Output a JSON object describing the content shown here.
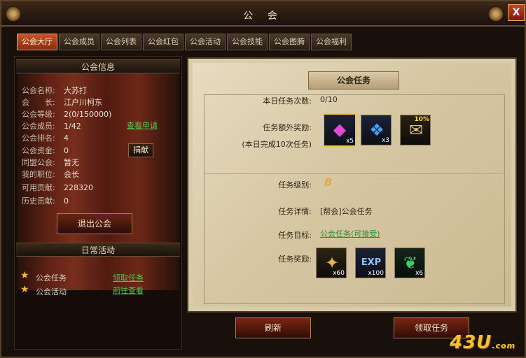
{
  "window": {
    "title": "公 会",
    "close_label": "X"
  },
  "tabs": [
    "公会大厅",
    "公会成员",
    "公会列表",
    "公会红包",
    "公会活动",
    "公会技能",
    "公会图腾",
    "公会福利"
  ],
  "left": {
    "info_header": "公会信息",
    "rows": [
      {
        "label": "公会名称:",
        "value": "大苏打"
      },
      {
        "label": "会　　长:",
        "value": "江户川柯东"
      },
      {
        "label": "公会等级:",
        "value": "2(0/150000)"
      },
      {
        "label": "公会成员:",
        "value": "1/42"
      },
      {
        "label": "公会排名:",
        "value": "4"
      },
      {
        "label": "公会资金:",
        "value": "0"
      },
      {
        "label": "同盟公会:",
        "value": "暂无"
      },
      {
        "label": "我的职位:",
        "value": "会长"
      },
      {
        "label": "可用贡献:",
        "value": "228320"
      },
      {
        "label": "历史贡献:",
        "value": "0"
      }
    ],
    "view_applications": "查看申请",
    "donate_label": "捐献",
    "quit_label": "退出公会",
    "daily_header": "日常活动",
    "daily": [
      {
        "name": "公会任务",
        "action": "领取任务"
      },
      {
        "name": "公会活动",
        "action": "前往查看"
      }
    ]
  },
  "mission": {
    "title": "公会任务",
    "count_label": "本日任务次数:",
    "count_value": "0/10",
    "extra_reward_label": "任务额外奖励:",
    "extra_reward_note": "(本日完成10次任务)",
    "extra_items": [
      {
        "icon": "purple-gem-icon",
        "glyph": "◆",
        "qty": "x5"
      },
      {
        "icon": "blue-flame-crystal-icon",
        "glyph": "❖",
        "qty": "x3"
      },
      {
        "icon": "scroll-icon",
        "glyph": "✉",
        "pct": "10%"
      }
    ],
    "level_label": "任务级别:",
    "level_value": "B",
    "detail_label": "任务详情:",
    "detail_value": "[帮会]公会任务",
    "target_label": "任务目标:",
    "target_value": "公会任务(可接受)",
    "reward_label": "任务奖励:",
    "reward_items": [
      {
        "icon": "contribution-token-icon",
        "glyph": "✦",
        "qty": "x60"
      },
      {
        "icon": "exp-icon",
        "glyph": "EXP",
        "qty": "x100"
      },
      {
        "icon": "green-leaf-icon",
        "glyph": "❦",
        "qty": "x6"
      }
    ]
  },
  "buttons": {
    "refresh": "刷新",
    "accept": "领取任务"
  },
  "watermark": {
    "logo": "43U",
    "suffix": ".com"
  },
  "colors": {
    "accent": "#c5552a",
    "link_green": "#4fc84b",
    "gold": "#f2c23d"
  }
}
